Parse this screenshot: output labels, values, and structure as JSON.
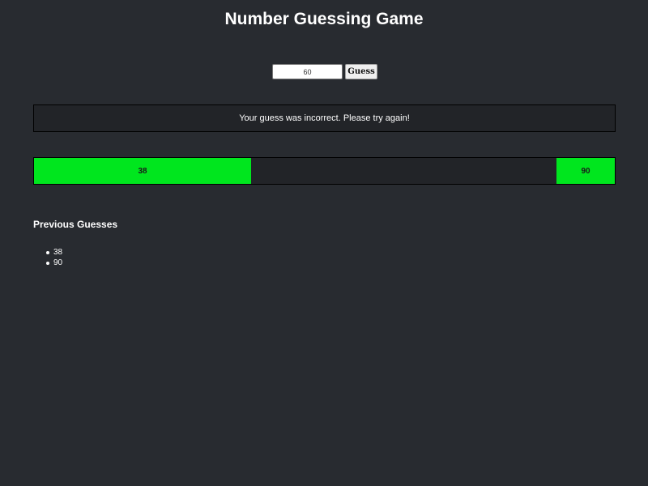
{
  "game": {
    "title": "Number Guessing Game"
  },
  "guess_form": {
    "input_value": "60",
    "button_label": "Guess"
  },
  "message": {
    "text": "Your guess was incorrect. Please try again!"
  },
  "range": {
    "min": 1,
    "max": 100,
    "low_guess": 38,
    "high_guess": 90,
    "low_label": "38",
    "high_label": "90",
    "fill_color": "#00e61e"
  },
  "history": {
    "title": "Previous Guesses",
    "guesses": [
      "38",
      "90"
    ]
  }
}
